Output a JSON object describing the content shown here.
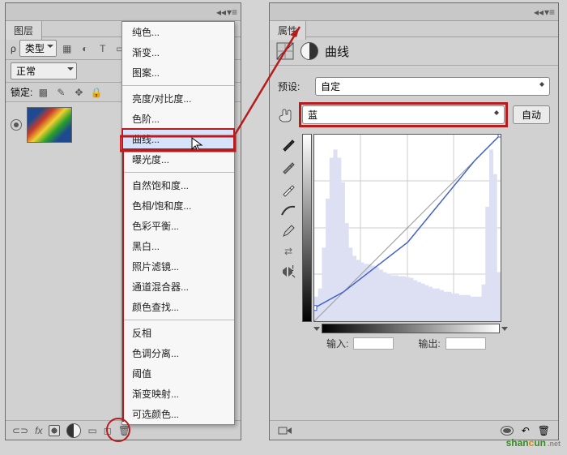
{
  "layers_panel": {
    "title": "图层",
    "filter": "类型",
    "blend_mode": "正常",
    "lock_label": "锁定:"
  },
  "context_menu": {
    "group1": [
      "纯色...",
      "渐变...",
      "图案..."
    ],
    "group2": [
      "亮度/对比度...",
      "色阶...",
      "曲线...",
      "曝光度..."
    ],
    "group3": [
      "自然饱和度...",
      "色相/饱和度...",
      "色彩平衡...",
      "黑白...",
      "照片滤镜...",
      "通道混合器...",
      "颜色查找..."
    ],
    "group4": [
      "反相",
      "色调分离...",
      "阈值",
      "渐变映射...",
      "可选颜色..."
    ],
    "highlighted": "曲线..."
  },
  "properties_panel": {
    "title": "属性",
    "heading": "曲线",
    "preset_label": "预设:",
    "preset_value": "自定",
    "channel_value": "蓝",
    "auto_button": "自动",
    "input_label": "输入:",
    "output_label": "输出:"
  },
  "chart_data": {
    "type": "line",
    "title": "曲线",
    "xlabel": "输入",
    "ylabel": "输出",
    "xlim": [
      0,
      255
    ],
    "ylim": [
      0,
      255
    ],
    "series": [
      {
        "name": "reference",
        "x": [
          0,
          255
        ],
        "y": [
          0,
          255
        ]
      },
      {
        "name": "blue-curve",
        "x": [
          0,
          40,
          128,
          220,
          255
        ],
        "y": [
          18,
          40,
          108,
          220,
          255
        ]
      }
    ],
    "histogram": [
      30,
      40,
      90,
      150,
      200,
      210,
      200,
      170,
      120,
      90,
      80,
      75,
      72,
      70,
      70,
      68,
      66,
      63,
      60,
      58,
      56,
      56,
      55,
      55,
      54,
      53,
      50,
      48,
      46,
      44,
      42,
      40,
      40,
      38,
      36,
      36,
      34,
      34,
      32,
      32,
      32,
      30,
      30,
      30,
      45,
      140,
      210,
      180,
      60,
      30
    ]
  },
  "watermark": "shancun"
}
